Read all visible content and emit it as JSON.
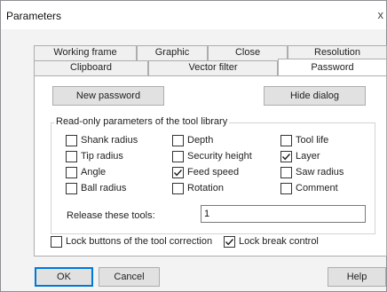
{
  "window": {
    "title": "Parameters",
    "close_glyph": "x"
  },
  "tabs_back": [
    "Working frame",
    "Graphic",
    "Close",
    "Resolution"
  ],
  "tabs_front": [
    "Clipboard",
    "Vector filter",
    "Password"
  ],
  "active_tab": "Password",
  "buttons": {
    "new_password": "New password",
    "hide_dialog": "Hide dialog",
    "ok": "OK",
    "cancel": "Cancel",
    "help": "Help"
  },
  "group": {
    "title": "Read-only parameters of the tool library",
    "options": [
      {
        "label": "Shank radius",
        "checked": false
      },
      {
        "label": "Tip radius",
        "checked": false
      },
      {
        "label": "Angle",
        "checked": false
      },
      {
        "label": "Ball radius",
        "checked": false
      },
      {
        "label": "Depth",
        "checked": false
      },
      {
        "label": "Security height",
        "checked": false
      },
      {
        "label": "Feed speed",
        "checked": true
      },
      {
        "label": "Rotation",
        "checked": false
      },
      {
        "label": "Tool life",
        "checked": false
      },
      {
        "label": "Layer",
        "checked": true
      },
      {
        "label": "Saw radius",
        "checked": false
      },
      {
        "label": "Comment",
        "checked": false
      }
    ],
    "release_label": "Release these tools:",
    "release_value": "1"
  },
  "locks": [
    {
      "label": "Lock buttons of the tool correction",
      "checked": false
    },
    {
      "label": "Lock break control",
      "checked": true
    }
  ]
}
